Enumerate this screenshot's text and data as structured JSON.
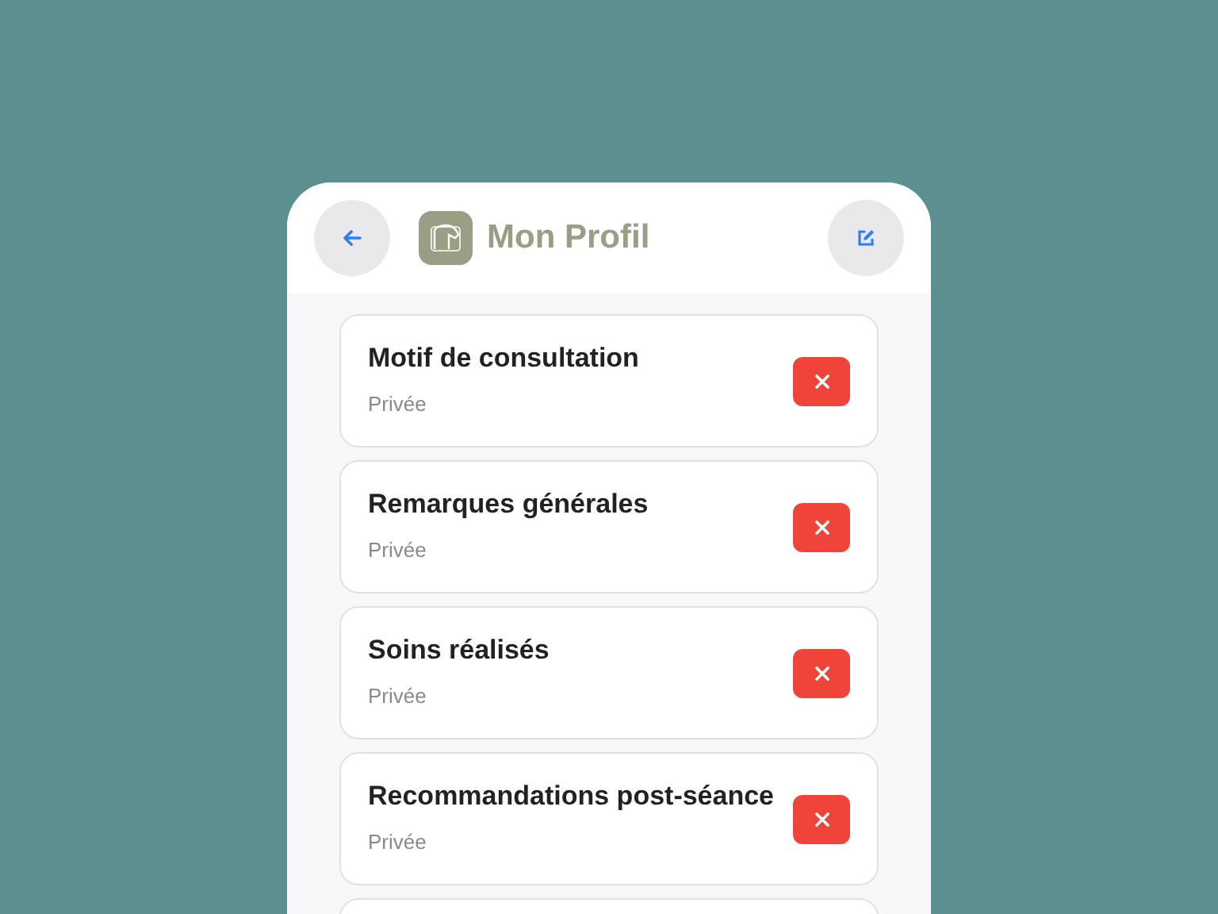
{
  "header": {
    "title": "Mon Profil"
  },
  "items": [
    {
      "title": "Motif de consultation",
      "visibility": "Privée"
    },
    {
      "title": "Remarques générales",
      "visibility": "Privée"
    },
    {
      "title": "Soins réalisés",
      "visibility": "Privée"
    },
    {
      "title": "Recommandations post-séance",
      "visibility": "Privée"
    }
  ]
}
